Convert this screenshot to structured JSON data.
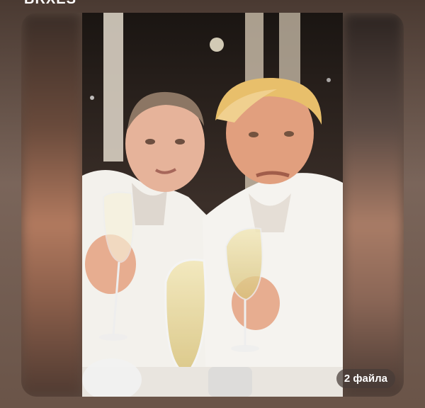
{
  "header": {
    "title": "BRXES"
  },
  "media": {
    "files_badge": "2 файла"
  }
}
